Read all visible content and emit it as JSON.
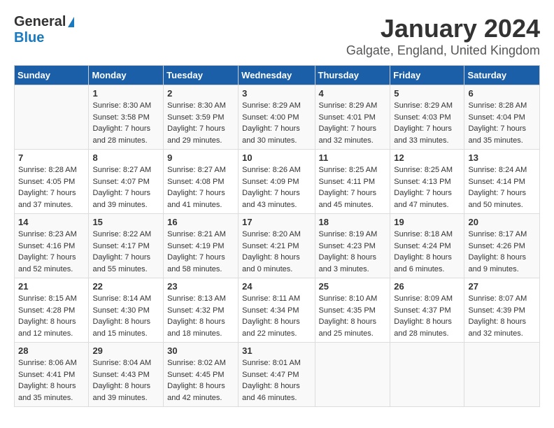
{
  "logo": {
    "general": "General",
    "blue": "Blue"
  },
  "title": {
    "month": "January 2024",
    "location": "Galgate, England, United Kingdom"
  },
  "headers": [
    "Sunday",
    "Monday",
    "Tuesday",
    "Wednesday",
    "Thursday",
    "Friday",
    "Saturday"
  ],
  "weeks": [
    [
      {
        "day": "",
        "sunrise": "",
        "sunset": "",
        "daylight": ""
      },
      {
        "day": "1",
        "sunrise": "Sunrise: 8:30 AM",
        "sunset": "Sunset: 3:58 PM",
        "daylight": "Daylight: 7 hours and 28 minutes."
      },
      {
        "day": "2",
        "sunrise": "Sunrise: 8:30 AM",
        "sunset": "Sunset: 3:59 PM",
        "daylight": "Daylight: 7 hours and 29 minutes."
      },
      {
        "day": "3",
        "sunrise": "Sunrise: 8:29 AM",
        "sunset": "Sunset: 4:00 PM",
        "daylight": "Daylight: 7 hours and 30 minutes."
      },
      {
        "day": "4",
        "sunrise": "Sunrise: 8:29 AM",
        "sunset": "Sunset: 4:01 PM",
        "daylight": "Daylight: 7 hours and 32 minutes."
      },
      {
        "day": "5",
        "sunrise": "Sunrise: 8:29 AM",
        "sunset": "Sunset: 4:03 PM",
        "daylight": "Daylight: 7 hours and 33 minutes."
      },
      {
        "day": "6",
        "sunrise": "Sunrise: 8:28 AM",
        "sunset": "Sunset: 4:04 PM",
        "daylight": "Daylight: 7 hours and 35 minutes."
      }
    ],
    [
      {
        "day": "7",
        "sunrise": "Sunrise: 8:28 AM",
        "sunset": "Sunset: 4:05 PM",
        "daylight": "Daylight: 7 hours and 37 minutes."
      },
      {
        "day": "8",
        "sunrise": "Sunrise: 8:27 AM",
        "sunset": "Sunset: 4:07 PM",
        "daylight": "Daylight: 7 hours and 39 minutes."
      },
      {
        "day": "9",
        "sunrise": "Sunrise: 8:27 AM",
        "sunset": "Sunset: 4:08 PM",
        "daylight": "Daylight: 7 hours and 41 minutes."
      },
      {
        "day": "10",
        "sunrise": "Sunrise: 8:26 AM",
        "sunset": "Sunset: 4:09 PM",
        "daylight": "Daylight: 7 hours and 43 minutes."
      },
      {
        "day": "11",
        "sunrise": "Sunrise: 8:25 AM",
        "sunset": "Sunset: 4:11 PM",
        "daylight": "Daylight: 7 hours and 45 minutes."
      },
      {
        "day": "12",
        "sunrise": "Sunrise: 8:25 AM",
        "sunset": "Sunset: 4:13 PM",
        "daylight": "Daylight: 7 hours and 47 minutes."
      },
      {
        "day": "13",
        "sunrise": "Sunrise: 8:24 AM",
        "sunset": "Sunset: 4:14 PM",
        "daylight": "Daylight: 7 hours and 50 minutes."
      }
    ],
    [
      {
        "day": "14",
        "sunrise": "Sunrise: 8:23 AM",
        "sunset": "Sunset: 4:16 PM",
        "daylight": "Daylight: 7 hours and 52 minutes."
      },
      {
        "day": "15",
        "sunrise": "Sunrise: 8:22 AM",
        "sunset": "Sunset: 4:17 PM",
        "daylight": "Daylight: 7 hours and 55 minutes."
      },
      {
        "day": "16",
        "sunrise": "Sunrise: 8:21 AM",
        "sunset": "Sunset: 4:19 PM",
        "daylight": "Daylight: 7 hours and 58 minutes."
      },
      {
        "day": "17",
        "sunrise": "Sunrise: 8:20 AM",
        "sunset": "Sunset: 4:21 PM",
        "daylight": "Daylight: 8 hours and 0 minutes."
      },
      {
        "day": "18",
        "sunrise": "Sunrise: 8:19 AM",
        "sunset": "Sunset: 4:23 PM",
        "daylight": "Daylight: 8 hours and 3 minutes."
      },
      {
        "day": "19",
        "sunrise": "Sunrise: 8:18 AM",
        "sunset": "Sunset: 4:24 PM",
        "daylight": "Daylight: 8 hours and 6 minutes."
      },
      {
        "day": "20",
        "sunrise": "Sunrise: 8:17 AM",
        "sunset": "Sunset: 4:26 PM",
        "daylight": "Daylight: 8 hours and 9 minutes."
      }
    ],
    [
      {
        "day": "21",
        "sunrise": "Sunrise: 8:15 AM",
        "sunset": "Sunset: 4:28 PM",
        "daylight": "Daylight: 8 hours and 12 minutes."
      },
      {
        "day": "22",
        "sunrise": "Sunrise: 8:14 AM",
        "sunset": "Sunset: 4:30 PM",
        "daylight": "Daylight: 8 hours and 15 minutes."
      },
      {
        "day": "23",
        "sunrise": "Sunrise: 8:13 AM",
        "sunset": "Sunset: 4:32 PM",
        "daylight": "Daylight: 8 hours and 18 minutes."
      },
      {
        "day": "24",
        "sunrise": "Sunrise: 8:11 AM",
        "sunset": "Sunset: 4:34 PM",
        "daylight": "Daylight: 8 hours and 22 minutes."
      },
      {
        "day": "25",
        "sunrise": "Sunrise: 8:10 AM",
        "sunset": "Sunset: 4:35 PM",
        "daylight": "Daylight: 8 hours and 25 minutes."
      },
      {
        "day": "26",
        "sunrise": "Sunrise: 8:09 AM",
        "sunset": "Sunset: 4:37 PM",
        "daylight": "Daylight: 8 hours and 28 minutes."
      },
      {
        "day": "27",
        "sunrise": "Sunrise: 8:07 AM",
        "sunset": "Sunset: 4:39 PM",
        "daylight": "Daylight: 8 hours and 32 minutes."
      }
    ],
    [
      {
        "day": "28",
        "sunrise": "Sunrise: 8:06 AM",
        "sunset": "Sunset: 4:41 PM",
        "daylight": "Daylight: 8 hours and 35 minutes."
      },
      {
        "day": "29",
        "sunrise": "Sunrise: 8:04 AM",
        "sunset": "Sunset: 4:43 PM",
        "daylight": "Daylight: 8 hours and 39 minutes."
      },
      {
        "day": "30",
        "sunrise": "Sunrise: 8:02 AM",
        "sunset": "Sunset: 4:45 PM",
        "daylight": "Daylight: 8 hours and 42 minutes."
      },
      {
        "day": "31",
        "sunrise": "Sunrise: 8:01 AM",
        "sunset": "Sunset: 4:47 PM",
        "daylight": "Daylight: 8 hours and 46 minutes."
      },
      {
        "day": "",
        "sunrise": "",
        "sunset": "",
        "daylight": ""
      },
      {
        "day": "",
        "sunrise": "",
        "sunset": "",
        "daylight": ""
      },
      {
        "day": "",
        "sunrise": "",
        "sunset": "",
        "daylight": ""
      }
    ]
  ]
}
